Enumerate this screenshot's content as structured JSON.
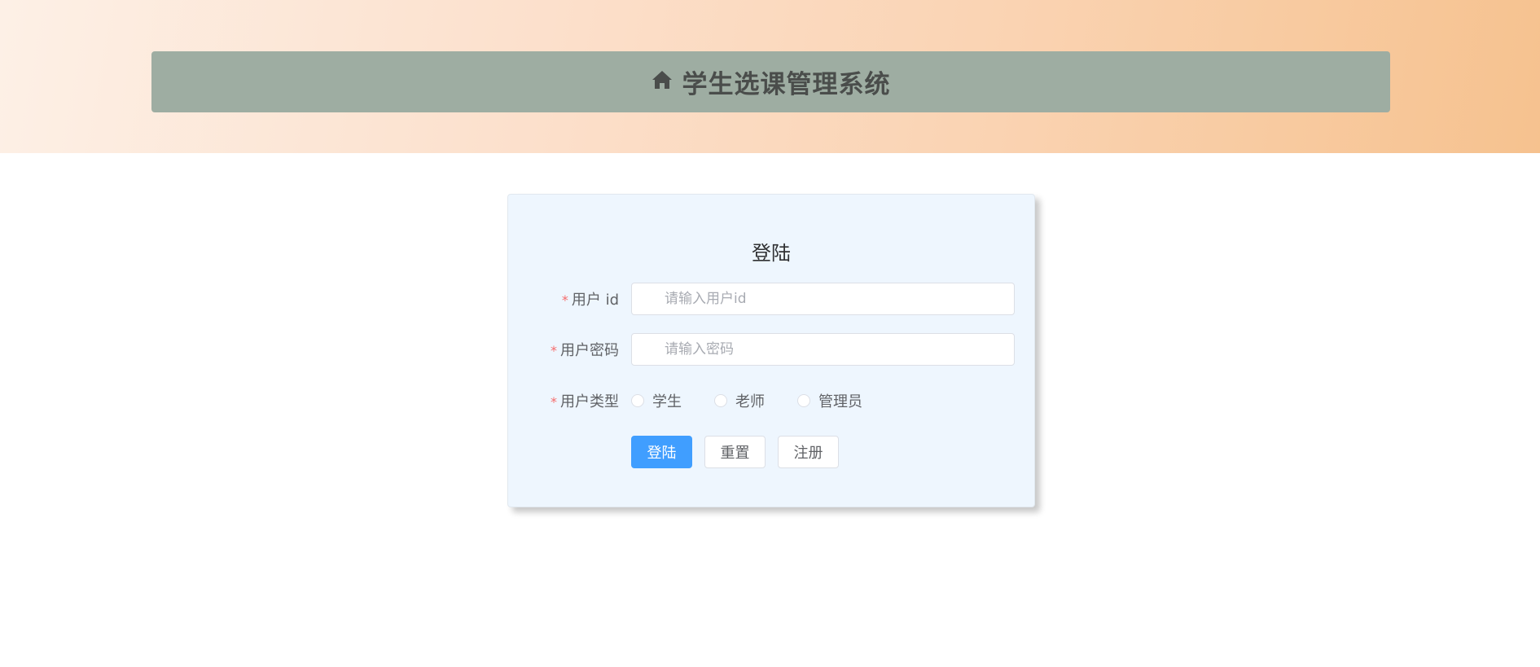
{
  "header": {
    "title": "学生选课管理系统",
    "icon": "home-icon"
  },
  "login": {
    "title": "登陆",
    "fields": {
      "user_id": {
        "label": "用户 id",
        "placeholder": "请输入用户id",
        "value": ""
      },
      "password": {
        "label": "用户密码",
        "placeholder": "请输入密码",
        "value": ""
      },
      "user_type": {
        "label": "用户类型",
        "options": [
          "学生",
          "老师",
          "管理员"
        ],
        "selected": null
      }
    },
    "required_mark": "*",
    "buttons": {
      "login": "登陆",
      "reset": "重置",
      "register": "注册"
    }
  },
  "colors": {
    "primary": "#409eff",
    "required": "#f56c6c",
    "title_bar": "#9eada2",
    "card_bg": "#eef6fe"
  }
}
